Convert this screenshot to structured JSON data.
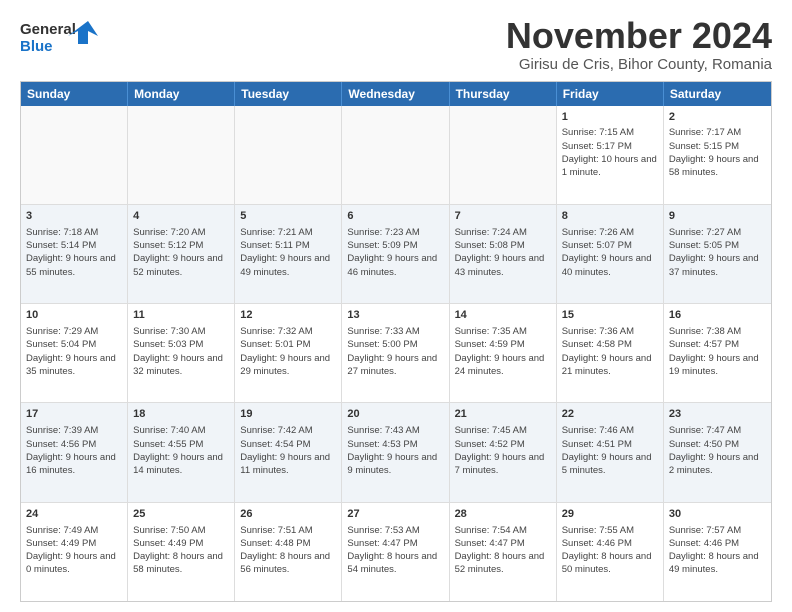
{
  "logo": {
    "line1": "General",
    "line2": "Blue"
  },
  "title": "November 2024",
  "subtitle": "Girisu de Cris, Bihor County, Romania",
  "days_of_week": [
    "Sunday",
    "Monday",
    "Tuesday",
    "Wednesday",
    "Thursday",
    "Friday",
    "Saturday"
  ],
  "rows": [
    [
      {
        "day": "",
        "info": "",
        "empty": true
      },
      {
        "day": "",
        "info": "",
        "empty": true
      },
      {
        "day": "",
        "info": "",
        "empty": true
      },
      {
        "day": "",
        "info": "",
        "empty": true
      },
      {
        "day": "",
        "info": "",
        "empty": true
      },
      {
        "day": "1",
        "info": "Sunrise: 7:15 AM\nSunset: 5:17 PM\nDaylight: 10 hours and 1 minute."
      },
      {
        "day": "2",
        "info": "Sunrise: 7:17 AM\nSunset: 5:15 PM\nDaylight: 9 hours and 58 minutes."
      }
    ],
    [
      {
        "day": "3",
        "info": "Sunrise: 7:18 AM\nSunset: 5:14 PM\nDaylight: 9 hours and 55 minutes."
      },
      {
        "day": "4",
        "info": "Sunrise: 7:20 AM\nSunset: 5:12 PM\nDaylight: 9 hours and 52 minutes."
      },
      {
        "day": "5",
        "info": "Sunrise: 7:21 AM\nSunset: 5:11 PM\nDaylight: 9 hours and 49 minutes."
      },
      {
        "day": "6",
        "info": "Sunrise: 7:23 AM\nSunset: 5:09 PM\nDaylight: 9 hours and 46 minutes."
      },
      {
        "day": "7",
        "info": "Sunrise: 7:24 AM\nSunset: 5:08 PM\nDaylight: 9 hours and 43 minutes."
      },
      {
        "day": "8",
        "info": "Sunrise: 7:26 AM\nSunset: 5:07 PM\nDaylight: 9 hours and 40 minutes."
      },
      {
        "day": "9",
        "info": "Sunrise: 7:27 AM\nSunset: 5:05 PM\nDaylight: 9 hours and 37 minutes."
      }
    ],
    [
      {
        "day": "10",
        "info": "Sunrise: 7:29 AM\nSunset: 5:04 PM\nDaylight: 9 hours and 35 minutes."
      },
      {
        "day": "11",
        "info": "Sunrise: 7:30 AM\nSunset: 5:03 PM\nDaylight: 9 hours and 32 minutes."
      },
      {
        "day": "12",
        "info": "Sunrise: 7:32 AM\nSunset: 5:01 PM\nDaylight: 9 hours and 29 minutes."
      },
      {
        "day": "13",
        "info": "Sunrise: 7:33 AM\nSunset: 5:00 PM\nDaylight: 9 hours and 27 minutes."
      },
      {
        "day": "14",
        "info": "Sunrise: 7:35 AM\nSunset: 4:59 PM\nDaylight: 9 hours and 24 minutes."
      },
      {
        "day": "15",
        "info": "Sunrise: 7:36 AM\nSunset: 4:58 PM\nDaylight: 9 hours and 21 minutes."
      },
      {
        "day": "16",
        "info": "Sunrise: 7:38 AM\nSunset: 4:57 PM\nDaylight: 9 hours and 19 minutes."
      }
    ],
    [
      {
        "day": "17",
        "info": "Sunrise: 7:39 AM\nSunset: 4:56 PM\nDaylight: 9 hours and 16 minutes."
      },
      {
        "day": "18",
        "info": "Sunrise: 7:40 AM\nSunset: 4:55 PM\nDaylight: 9 hours and 14 minutes."
      },
      {
        "day": "19",
        "info": "Sunrise: 7:42 AM\nSunset: 4:54 PM\nDaylight: 9 hours and 11 minutes."
      },
      {
        "day": "20",
        "info": "Sunrise: 7:43 AM\nSunset: 4:53 PM\nDaylight: 9 hours and 9 minutes."
      },
      {
        "day": "21",
        "info": "Sunrise: 7:45 AM\nSunset: 4:52 PM\nDaylight: 9 hours and 7 minutes."
      },
      {
        "day": "22",
        "info": "Sunrise: 7:46 AM\nSunset: 4:51 PM\nDaylight: 9 hours and 5 minutes."
      },
      {
        "day": "23",
        "info": "Sunrise: 7:47 AM\nSunset: 4:50 PM\nDaylight: 9 hours and 2 minutes."
      }
    ],
    [
      {
        "day": "24",
        "info": "Sunrise: 7:49 AM\nSunset: 4:49 PM\nDaylight: 9 hours and 0 minutes."
      },
      {
        "day": "25",
        "info": "Sunrise: 7:50 AM\nSunset: 4:49 PM\nDaylight: 8 hours and 58 minutes."
      },
      {
        "day": "26",
        "info": "Sunrise: 7:51 AM\nSunset: 4:48 PM\nDaylight: 8 hours and 56 minutes."
      },
      {
        "day": "27",
        "info": "Sunrise: 7:53 AM\nSunset: 4:47 PM\nDaylight: 8 hours and 54 minutes."
      },
      {
        "day": "28",
        "info": "Sunrise: 7:54 AM\nSunset: 4:47 PM\nDaylight: 8 hours and 52 minutes."
      },
      {
        "day": "29",
        "info": "Sunrise: 7:55 AM\nSunset: 4:46 PM\nDaylight: 8 hours and 50 minutes."
      },
      {
        "day": "30",
        "info": "Sunrise: 7:57 AM\nSunset: 4:46 PM\nDaylight: 8 hours and 49 minutes."
      }
    ]
  ]
}
